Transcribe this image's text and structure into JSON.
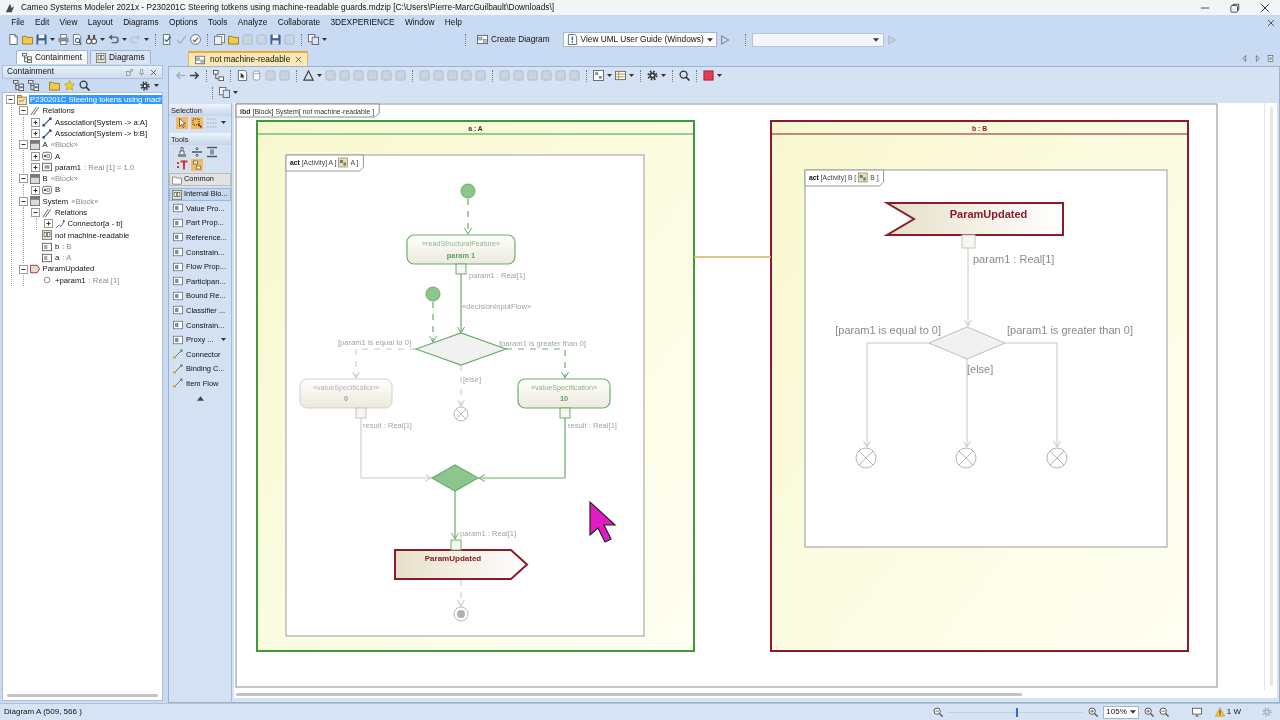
{
  "window": {
    "title": "Cameo Systems Modeler 2021x - P230201C Steering totkens using machine-readable guards.mdzip [C:\\Users\\Pierre-MarcGuilbault\\Downloads\\]"
  },
  "menu_bar": [
    "File",
    "Edit",
    "View",
    "Layout",
    "Diagrams",
    "Options",
    "Tools",
    "Analyze",
    "Collaborate",
    "3DEXPERIENCE",
    "Window",
    "Help"
  ],
  "toolbar": {
    "create_diagram": "Create Diagram",
    "guide": "View UML User Guide (Windows)"
  },
  "browser": {
    "tabs": [
      {
        "label": "Containment",
        "selected": true
      },
      {
        "label": "Diagrams",
        "selected": false
      }
    ],
    "title": "Containment",
    "tree": [
      {
        "kind": "package",
        "label": "P230201C Steering tokens using mach",
        "expanded": true,
        "selected": true,
        "children": [
          {
            "kind": "relations",
            "label": "Relations",
            "expanded": true,
            "selected": false,
            "children": [
              {
                "kind": "association",
                "label": "Association[System -> a:A]",
                "expanded": false,
                "selected": false
              },
              {
                "kind": "association",
                "label": "Association[System -> b:B]",
                "expanded": false,
                "selected": false
              }
            ]
          },
          {
            "kind": "block",
            "label": "A",
            "suffix": "«Block»",
            "expanded": true,
            "selected": false,
            "children": [
              {
                "kind": "activity",
                "label": "A",
                "expanded": false,
                "selected": false
              },
              {
                "kind": "value_property",
                "label": "param1",
                "suffix": ": Real [1] = 1.0",
                "expanded": false,
                "selected": false
              }
            ]
          },
          {
            "kind": "block",
            "label": "B",
            "suffix": "«Block»",
            "expanded": true,
            "selected": false,
            "children": [
              {
                "kind": "activity",
                "label": "B",
                "expanded": false,
                "selected": false
              }
            ]
          },
          {
            "kind": "block",
            "label": "System",
            "suffix": "«Block»",
            "expanded": true,
            "selected": false,
            "children": [
              {
                "kind": "relations",
                "label": "Relations",
                "expanded": true,
                "selected": false,
                "children": [
                  {
                    "kind": "connector",
                    "label": "Connector[a - b]",
                    "expanded": false,
                    "selected": false
                  }
                ]
              },
              {
                "kind": "diagram",
                "label": "not machine-readable",
                "selected": false
              },
              {
                "kind": "part",
                "label": "b",
                "suffix": ": B",
                "selected": false
              },
              {
                "kind": "part",
                "label": "a",
                "suffix": ": A",
                "selected": false
              }
            ]
          },
          {
            "kind": "signal",
            "label": "ParamUpdated",
            "expanded": true,
            "selected": false,
            "children": [
              {
                "kind": "attribute",
                "label": "+param1",
                "suffix": ": Real [1]",
                "selected": false
              }
            ]
          }
        ]
      }
    ]
  },
  "diagram_tabs": [
    {
      "label": "not machine-readable",
      "selected": true
    }
  ],
  "palette": {
    "selection_title": "Selection",
    "tools_title": "Tools",
    "items": [
      {
        "kind": "folder",
        "label": "Common",
        "selected": false
      },
      {
        "kind": "group",
        "label": "Internal Blo...",
        "selected": true
      },
      {
        "kind": "tool",
        "label": "Value Pro...",
        "selected": false
      },
      {
        "kind": "tool",
        "label": "Part Prop...",
        "selected": false
      },
      {
        "kind": "tool",
        "label": "Reference...",
        "selected": false
      },
      {
        "kind": "tool",
        "label": "Constrain...",
        "selected": false
      },
      {
        "kind": "tool",
        "label": "Flow Prop...",
        "selected": false
      },
      {
        "kind": "tool",
        "label": "Participan...",
        "selected": false
      },
      {
        "kind": "tool",
        "label": "Bound Re...",
        "selected": false
      },
      {
        "kind": "tool",
        "label": "Classifier ...",
        "selected": false
      },
      {
        "kind": "tool",
        "label": "Constrain...",
        "selected": false
      },
      {
        "kind": "menu_tool",
        "label": "Proxy ...",
        "selected": false
      },
      {
        "kind": "link_tool",
        "label": "Connector",
        "selected": false
      },
      {
        "kind": "link_tool",
        "label": "Binding C...",
        "selected": false
      },
      {
        "kind": "link_tool",
        "label": "Item Flow",
        "selected": false
      }
    ]
  },
  "diagram": {
    "frame": {
      "keyword": "ibd",
      "label": "[Block] System[ not machine-readable ]"
    },
    "parts": [
      {
        "label": "a : A",
        "highlighted": true,
        "activity": {
          "keyword": "act",
          "label": "[Activity] A [",
          "label_end": "A ]",
          "nodes": [
            {
              "kind": "initial",
              "highlighted": true
            },
            {
              "kind": "action",
              "stereotype": "«readStructuralFeature»",
              "name": "param 1",
              "highlighted": true,
              "pin": {
                "label": "param1 : Real[1]",
                "highlighted": true
              }
            },
            {
              "kind": "initial",
              "highlighted": true
            },
            {
              "kind": "decision",
              "highlighted": true
            },
            {
              "kind": "action",
              "stereotype": "«valueSpecification»",
              "name": "0",
              "highlighted": false,
              "pin": {
                "label": "result : Real[1]",
                "highlighted": false
              }
            },
            {
              "kind": "flow_final",
              "highlighted": false
            },
            {
              "kind": "action",
              "stereotype": "«valueSpecification»",
              "name": "10",
              "highlighted": true,
              "pin": {
                "label": "result : Real[1]",
                "highlighted": true
              }
            },
            {
              "kind": "merge",
              "highlighted": true
            },
            {
              "kind": "send_signal",
              "name": "ParamUpdated",
              "highlighted": false,
              "pin": {
                "label": "param1 : Real[1]",
                "highlighted": true
              }
            },
            {
              "kind": "activity_final",
              "highlighted": false
            }
          ],
          "flows": [
            {
              "kind": "control",
              "highlighted": true
            },
            {
              "kind": "object",
              "label": "«decisionInputFlow»",
              "highlighted": true
            },
            {
              "kind": "control",
              "highlighted": true
            },
            {
              "kind": "control",
              "guard": "[param1 is equal to 0]",
              "highlighted": false
            },
            {
              "kind": "control",
              "guard": "[param1 is greater than 0]",
              "highlighted": true
            },
            {
              "kind": "control",
              "guard": "[else]",
              "highlighted": false
            },
            {
              "kind": "object",
              "highlighted": false
            },
            {
              "kind": "object",
              "highlighted": true
            },
            {
              "kind": "object",
              "highlighted": true
            },
            {
              "kind": "control",
              "highlighted": false
            }
          ]
        }
      },
      {
        "label": "b : B",
        "highlighted": false,
        "activity": {
          "keyword": "act",
          "label": "[Activity] B [",
          "label_end": "B ]",
          "nodes": [
            {
              "kind": "accept_event",
              "name": "ParamUpdated",
              "highlighted": false,
              "pin": {
                "label": "param1 : Real[1]",
                "highlighted": false
              }
            },
            {
              "kind": "decision",
              "highlighted": false
            },
            {
              "kind": "flow_final",
              "highlighted": false
            },
            {
              "kind": "flow_final",
              "highlighted": false
            },
            {
              "kind": "flow_final",
              "highlighted": false
            }
          ],
          "flows": [
            {
              "kind": "object",
              "highlighted": false
            },
            {
              "kind": "object",
              "guard": "[param1 is equal to 0]",
              "highlighted": false
            },
            {
              "kind": "object",
              "guard": "[param1 is greater than 0]",
              "highlighted": false
            },
            {
              "kind": "object",
              "guard": "[else]",
              "highlighted": false
            }
          ]
        }
      }
    ]
  },
  "status_bar": {
    "position": "Diagram A (509, 566 )",
    "zoom_slider": {
      "level": 0.5
    },
    "zoom": "105%",
    "warnings": "1 W"
  }
}
